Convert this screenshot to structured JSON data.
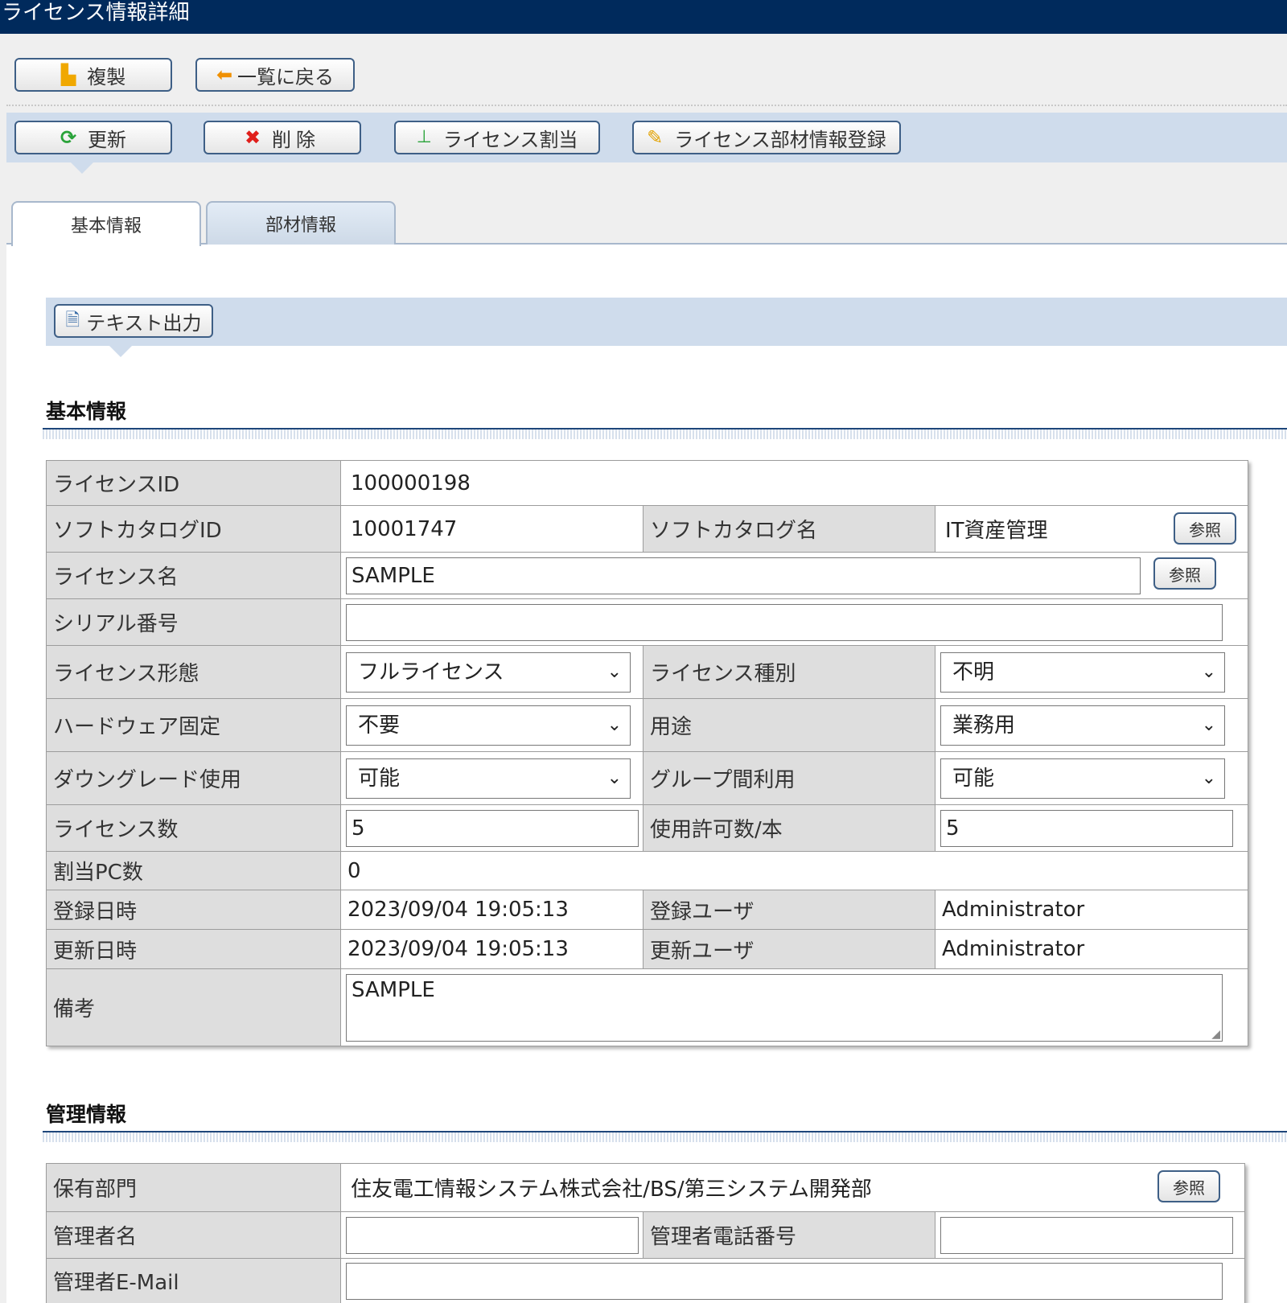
{
  "window": {
    "title": "ライセンス情報詳細"
  },
  "toolbar1": {
    "copy": "複製",
    "back": "一覧に戻る"
  },
  "toolbar2": {
    "update": "更新",
    "delete": "削除",
    "assign": "ライセンス割当",
    "parts_register": "ライセンス部材情報登録"
  },
  "tabs": {
    "basic": "基本情報",
    "parts": "部材情報"
  },
  "export": {
    "label": "テキスト出力"
  },
  "sections": {
    "basic": "基本情報",
    "management": "管理情報"
  },
  "ref_label": "参照",
  "basic": {
    "license_id": {
      "label": "ライセンスID",
      "value": "100000198"
    },
    "catalog_id": {
      "label": "ソフトカタログID",
      "value": "10001747"
    },
    "catalog_name": {
      "label": "ソフトカタログ名",
      "value": "IT資産管理"
    },
    "license_name": {
      "label": "ライセンス名",
      "value": "SAMPLE"
    },
    "serial": {
      "label": "シリアル番号",
      "value": ""
    },
    "license_form": {
      "label": "ライセンス形態",
      "value": "フルライセンス"
    },
    "license_type": {
      "label": "ライセンス種別",
      "value": "不明"
    },
    "hw_fixed": {
      "label": "ハードウェア固定",
      "value": "不要"
    },
    "purpose": {
      "label": "用途",
      "value": "業務用"
    },
    "downgrade": {
      "label": "ダウングレード使用",
      "value": "可能"
    },
    "group_use": {
      "label": "グループ間利用",
      "value": "可能"
    },
    "license_count": {
      "label": "ライセンス数",
      "value": "5"
    },
    "allowed_per": {
      "label": "使用許可数/本",
      "value": "5"
    },
    "assigned_pc": {
      "label": "割当PC数",
      "value": "0"
    },
    "created_at": {
      "label": "登録日時",
      "value": "2023/09/04 19:05:13"
    },
    "created_by": {
      "label": "登録ユーザ",
      "value": "Administrator"
    },
    "updated_at": {
      "label": "更新日時",
      "value": "2023/09/04 19:05:13"
    },
    "updated_by": {
      "label": "更新ユーザ",
      "value": "Administrator"
    },
    "remarks": {
      "label": "備考",
      "value": "SAMPLE"
    }
  },
  "management": {
    "owner_dept": {
      "label": "保有部門",
      "value": "住友電工情報システム株式会社/BS/第三システム開発部"
    },
    "manager_name": {
      "label": "管理者名",
      "value": ""
    },
    "manager_phone": {
      "label": "管理者電話番号",
      "value": ""
    },
    "manager_email": {
      "label": "管理者E-Mail",
      "value": ""
    }
  },
  "colors": {
    "title_bar": "#002a5c",
    "toolbar_bg": "#cfdcec",
    "label_bg": "#dedede",
    "delete_icon": "#e0201c",
    "update_icon": "#2aa33a",
    "copy_icon": "#f0a800"
  }
}
